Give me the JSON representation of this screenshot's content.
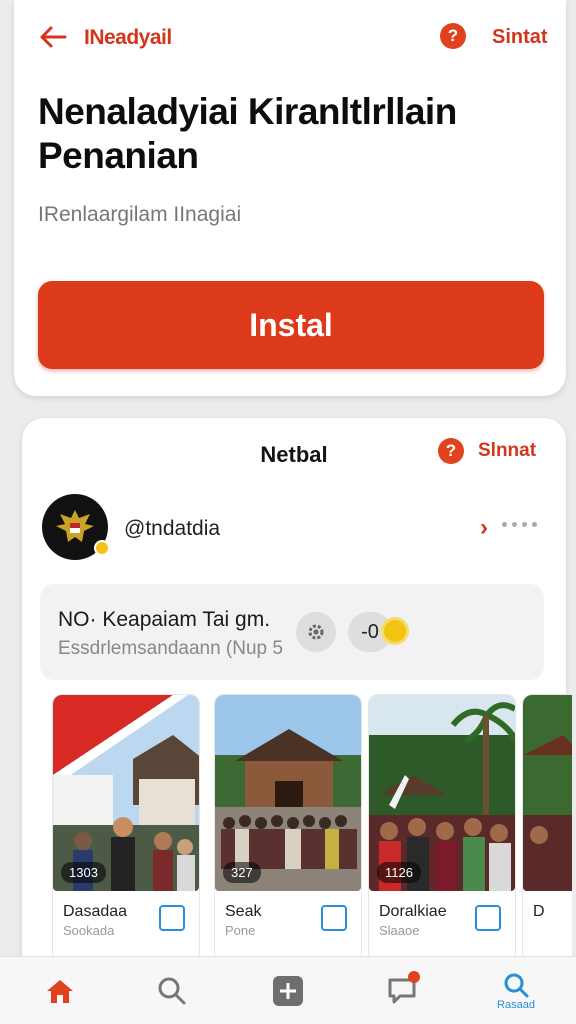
{
  "header": {
    "title": "INeadyail",
    "action_label": "Sintat",
    "help_label": "?"
  },
  "hero": {
    "headline": "Nenaladyiai Kiranltlrllain Penanian",
    "subtitle": "IRenlaargilam IInagiai",
    "install_label": "Instal"
  },
  "panel": {
    "title": "Netbal",
    "help_label": "?",
    "action_label": "Slnnat",
    "profile": {
      "handle": "@tndatdia",
      "chevron": "›"
    },
    "info": {
      "line1": "NO· Keapaiam Tai gm.",
      "line2": "Essdrlemsandaann (Nup 5",
      "counter": "-0"
    },
    "tiles": [
      {
        "count": "1303",
        "label": "Dasadaa",
        "sub": "Sookada"
      },
      {
        "count": "327",
        "label": "Seak",
        "sub": "Pone"
      },
      {
        "count": "1126",
        "label": "Doralkiae",
        "sub": "Slaaoe"
      },
      {
        "count": "",
        "label": "D",
        "sub": ""
      }
    ]
  },
  "bottom_nav": {
    "active_label": "Rasaad",
    "items": [
      "home-icon",
      "search-icon",
      "add-icon",
      "chat-icon",
      "profile-search-icon"
    ]
  },
  "colors": {
    "accent": "#dc3a1a",
    "link_blue": "#2a8fd6"
  }
}
